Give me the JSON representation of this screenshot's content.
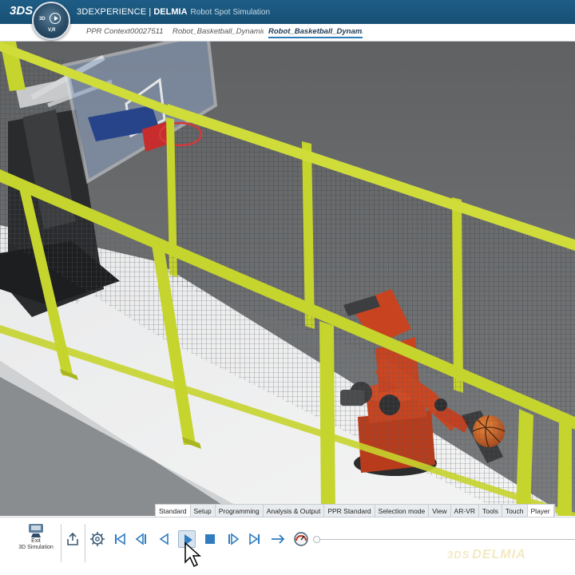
{
  "titlebar": {
    "logo": "3DS",
    "brand": "3DEXPERIENCE",
    "separator": " | ",
    "product": "DELMIA",
    "app_name": "Robot Spot Simulation",
    "compass_top": "3D",
    "compass_bottom": "V,R"
  },
  "tabs": [
    {
      "label": "PPR Context00027511",
      "active": false
    },
    {
      "label": "Robot_Basketball_Dynamics",
      "active": false
    },
    {
      "label": "Robot_Basketball_Dynamics",
      "active": true
    }
  ],
  "section_tabs": [
    {
      "label": "Standard",
      "active": true
    },
    {
      "label": "Setup",
      "active": false
    },
    {
      "label": "Programming",
      "active": false
    },
    {
      "label": "Analysis & Output",
      "active": false
    },
    {
      "label": "PPR Standard",
      "active": false
    },
    {
      "label": "Selection mode",
      "active": false
    },
    {
      "label": "View",
      "active": false
    },
    {
      "label": "AR-VR",
      "active": false
    },
    {
      "label": "Tools",
      "active": false
    },
    {
      "label": "Touch",
      "active": false
    },
    {
      "label": "Player",
      "active": false
    }
  ],
  "toolbar": {
    "exit_label_line1": "Exit",
    "exit_label_line2": "3D Simulation",
    "icons": [
      "exit-simulation-icon",
      "share-icon",
      "gear-icon",
      "skip-to-start-icon",
      "step-back-icon",
      "play-backward-icon",
      "play-icon",
      "stop-icon",
      "step-forward-icon",
      "skip-to-end-icon",
      "loop-arrow-icon",
      "speed-gauge-icon"
    ],
    "timeline_position": 0.0
  },
  "watermark": {
    "logo": "3DS",
    "text": "DELMIA"
  },
  "colors": {
    "title_bar": "#1b5780",
    "fence_yellow": "#c6d42e",
    "robot_orange": "#c8431f",
    "ball_orange": "#d26a22",
    "active_tab_underline": "#2c7cb6",
    "play_highlight": "#d7e3ee"
  }
}
